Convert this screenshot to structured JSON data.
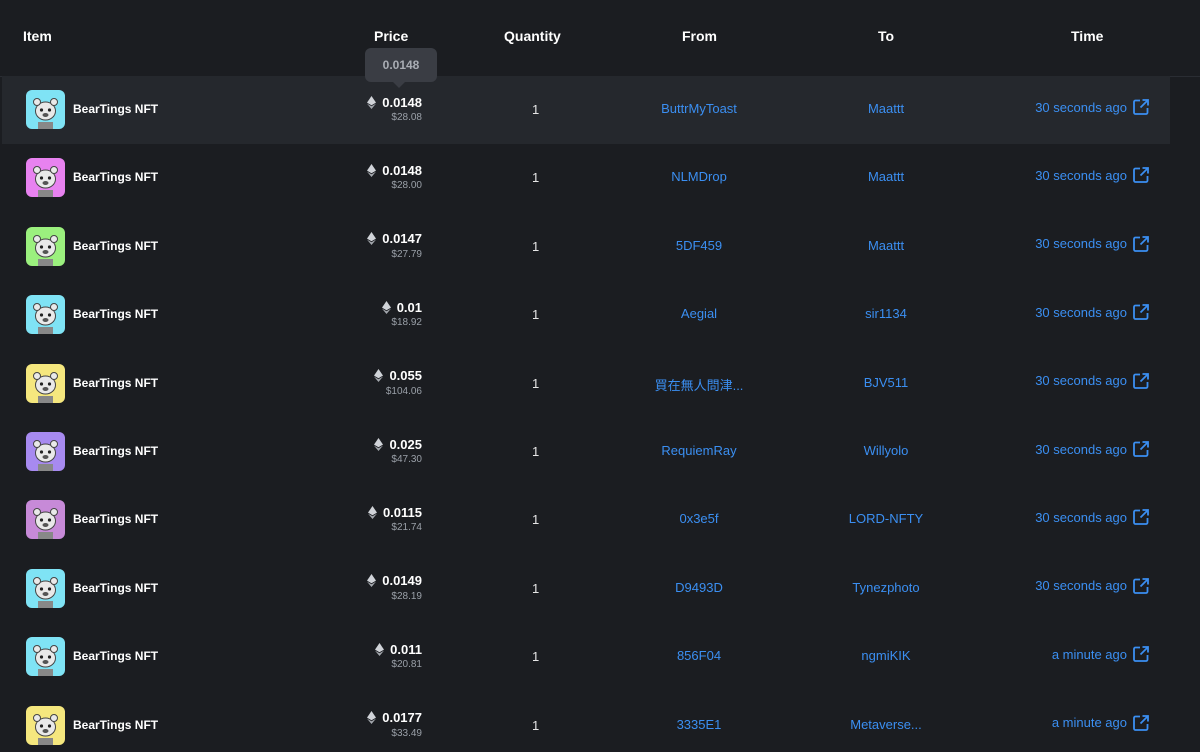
{
  "headers": {
    "item": "Item",
    "price": "Price",
    "quantity": "Quantity",
    "from": "From",
    "to": "To",
    "time": "Time"
  },
  "tooltip": "0.0148",
  "rows": [
    {
      "name": "BearTings NFT",
      "eth": "0.0148",
      "usd": "$28.08",
      "qty": "1",
      "from": "ButtrMyToast",
      "to": "Maattt",
      "time": "30 seconds ago",
      "avatar_bg": "#7fe3f5"
    },
    {
      "name": "BearTings NFT",
      "eth": "0.0148",
      "usd": "$28.00",
      "qty": "1",
      "from": "NLMDrop",
      "to": "Maattt",
      "time": "30 seconds ago",
      "avatar_bg": "#e882f0"
    },
    {
      "name": "BearTings NFT",
      "eth": "0.0147",
      "usd": "$27.79",
      "qty": "1",
      "from": "5DF459",
      "to": "Maattt",
      "time": "30 seconds ago",
      "avatar_bg": "#9bf07e"
    },
    {
      "name": "BearTings NFT",
      "eth": "0.01",
      "usd": "$18.92",
      "qty": "1",
      "from": "Aegial",
      "to": "sir1134",
      "time": "30 seconds ago",
      "avatar_bg": "#7fe3f5"
    },
    {
      "name": "BearTings NFT",
      "eth": "0.055",
      "usd": "$104.06",
      "qty": "1",
      "from": "買在無人問津...",
      "to": "BJV511",
      "time": "30 seconds ago",
      "avatar_bg": "#f5e77e"
    },
    {
      "name": "BearTings NFT",
      "eth": "0.025",
      "usd": "$47.30",
      "qty": "1",
      "from": "RequiemRay",
      "to": "Willyolo",
      "time": "30 seconds ago",
      "avatar_bg": "#a78af0"
    },
    {
      "name": "BearTings NFT",
      "eth": "0.0115",
      "usd": "$21.74",
      "qty": "1",
      "from": "0x3e5f",
      "to": "LORD-NFTY",
      "time": "30 seconds ago",
      "avatar_bg": "#c78ad8"
    },
    {
      "name": "BearTings NFT",
      "eth": "0.0149",
      "usd": "$28.19",
      "qty": "1",
      "from": "D9493D",
      "to": "Tynezphoto",
      "time": "30 seconds ago",
      "avatar_bg": "#7fe3f5"
    },
    {
      "name": "BearTings NFT",
      "eth": "0.011",
      "usd": "$20.81",
      "qty": "1",
      "from": "856F04",
      "to": "ngmiKIK",
      "time": "a minute ago",
      "avatar_bg": "#7fe3f5"
    },
    {
      "name": "BearTings NFT",
      "eth": "0.0177",
      "usd": "$33.49",
      "qty": "1",
      "from": "3335E1",
      "to": "Metaverse...",
      "time": "a minute ago",
      "avatar_bg": "#f5e77e"
    }
  ],
  "icons": {
    "currency": "ethereum-icon",
    "time_link": "external-link-icon"
  },
  "colors": {
    "background": "#1b1d21",
    "hover_row": "#25282d",
    "link": "#3b8ff2",
    "muted": "#9aa0a8"
  }
}
